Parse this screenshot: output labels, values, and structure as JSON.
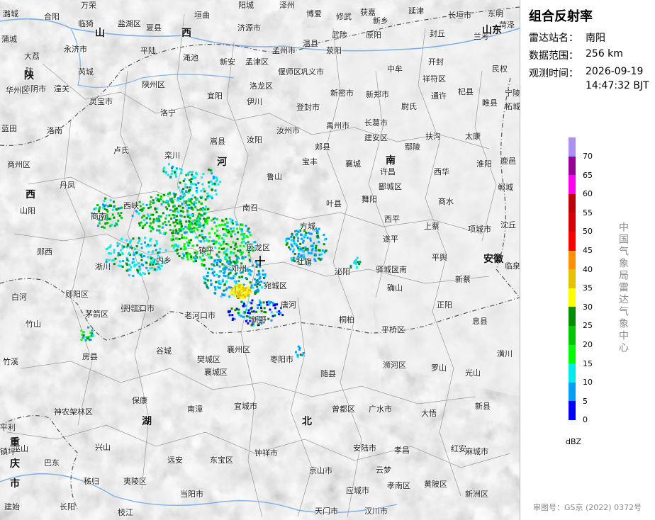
{
  "panel": {
    "title": "组合反射率",
    "station_label": "雷达站名：",
    "station_value": "南阳",
    "range_label": "数据范围：",
    "range_value": "256 km",
    "time_label": "观测时间：",
    "time_date": "2026-09-19",
    "time_clock": "14:47:32 BJT",
    "side_text": "中国气象局雷达气象中心",
    "footer": "审图号：GS京 (2022) 0372号"
  },
  "legend": {
    "unit": "dBZ",
    "labels": [
      "70",
      "65",
      "60",
      "55",
      "50",
      "45",
      "40",
      "35",
      "30",
      "25",
      "20",
      "15",
      "10",
      "5",
      "0"
    ],
    "colors": [
      "#ad90f0",
      "#960096",
      "#ff00f0",
      "#c00000",
      "#d60000",
      "#ff0000",
      "#ff9000",
      "#e7c000",
      "#ffff00",
      "#008e00",
      "#00c800",
      "#02fc02",
      "#00ecec",
      "#01a0f6",
      "#0000f6"
    ]
  },
  "map": {
    "provinces": [
      "山",
      "西",
      "山东",
      "河",
      "陕",
      "西",
      "南",
      "湖",
      "北",
      "安徽",
      "重",
      "庆",
      "市"
    ],
    "cities": [
      "潞城",
      "合阳",
      "万荣",
      "盐湖区",
      "垣曲",
      "阳城",
      "泽州",
      "博爱",
      "修武",
      "获嘉",
      "新乡",
      "延津",
      "长垣市",
      "东明",
      "菏泽",
      "蒲城",
      "临猗",
      "夏县",
      "济源市",
      "温县",
      "武陟",
      "原阳",
      "封丘",
      "兰考",
      "大荔",
      "永济市",
      "平陆",
      "渑池",
      "孟州市",
      "新安",
      "孟津区",
      "荥阳",
      "中牟",
      "开封",
      "民权",
      "陕",
      "潼关",
      "芮城",
      "陕州区",
      "宜阳",
      "洛龙区",
      "偃师区",
      "巩义市",
      "祥符区",
      "杞县",
      "宁陵",
      "华阴市",
      "华州区",
      "灵宝市",
      "伊川",
      "登封市",
      "新密市",
      "新郑市",
      "尉氏",
      "通许",
      "睢县",
      "柘城",
      "蓝田",
      "洛南",
      "洛宁",
      "嵩县",
      "汝阳",
      "汝州市",
      "禹州市",
      "长葛市",
      "建安区",
      "扶沟",
      "太康",
      "商州区",
      "卢氏",
      "栾川",
      "郏县",
      "宝丰",
      "襄城",
      "许昌",
      "鄢陵",
      "西华",
      "淮阳",
      "鹿邑",
      "丹凤",
      "西峡",
      "鲁山",
      "叶县",
      "舞阳",
      "郾城区",
      "商水",
      "郸城",
      "山阳",
      "南召",
      "方城",
      "西平",
      "上蔡",
      "项城市",
      "沈丘",
      "商南",
      "内乡",
      "镇平",
      "卧龙区",
      "社旗",
      "遂平",
      "汝南",
      "平舆",
      "临泉",
      "郧西",
      "淅川",
      "邓州",
      "宛城区",
      "泌阳",
      "驿城区",
      "确山",
      "新蔡",
      "白河",
      "郧阳区",
      "张湾区",
      "丹江口市",
      "唐河",
      "桐柏",
      "正阳",
      "息县",
      "竹山",
      "茅箭区",
      "老河口市",
      "新野",
      "平桥区",
      "潢川",
      "房县",
      "谷城",
      "樊城区",
      "襄州区",
      "襄城区",
      "枣阳市",
      "随县",
      "浉河区",
      "罗山",
      "光山",
      "竹溪",
      "保康",
      "南漳",
      "宜城市",
      "曾都区",
      "广水市",
      "大悟",
      "新县",
      "神农架林区",
      "兴山",
      "远安",
      "钟祥市",
      "东宝区",
      "安陆市",
      "孝昌",
      "红安",
      "麻城市",
      "巴东",
      "秭归",
      "夷陵区",
      "当阳市",
      "京山市",
      "应城市",
      "孝南区",
      "黄陂区",
      "新洲区",
      "建始",
      "长阳",
      "枝江",
      "天门市",
      "汉川市",
      "云梦",
      "巫山",
      "平利",
      "镇坪"
    ]
  }
}
